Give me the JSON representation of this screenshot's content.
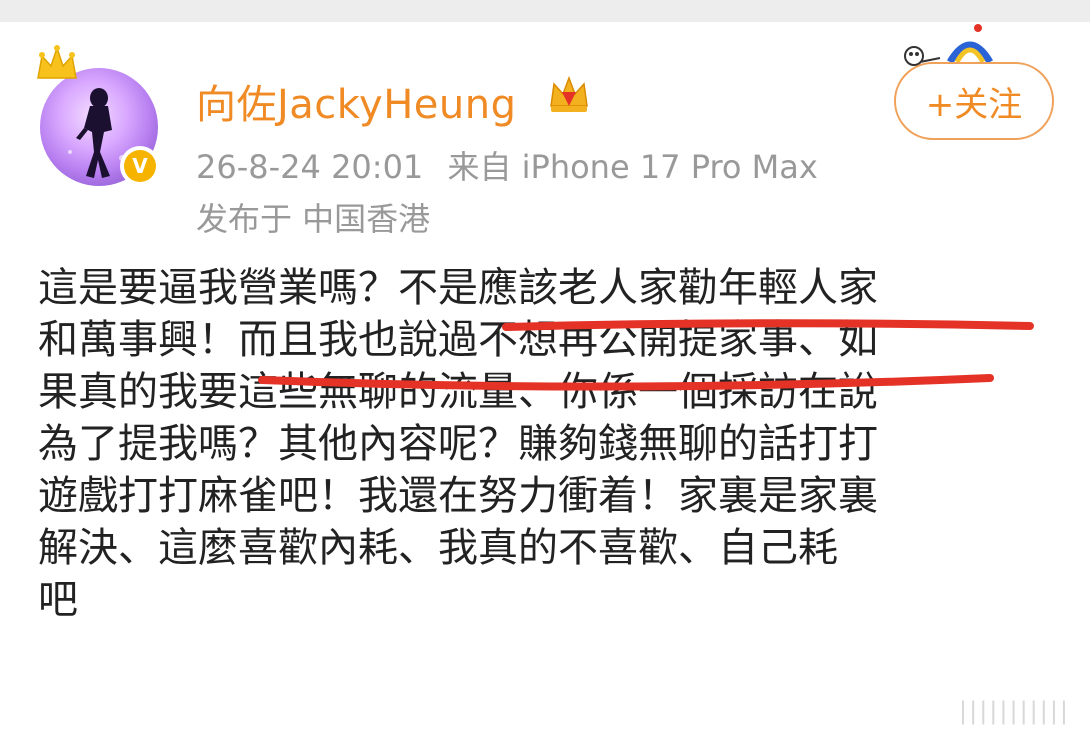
{
  "post": {
    "username": "向佐JackyHeung",
    "timestamp": "26-8-24 20:01",
    "source": "来自 iPhone 17 Pro Max",
    "location": "发布于 中国香港",
    "follow_label": "+关注",
    "lines": [
      "這是要逼我營業嗎？不是應該老人家勸年輕人家",
      "和萬事興！而且我也說過不想再公開提家事、如",
      "果真的我要這些無聊的流量、你係一個採訪在說",
      "為了提我嗎？其他內容呢？賺夠錢無聊的話打打",
      "遊戲打打麻雀吧！我還在努力衝着！家裏是家裏",
      "解決、這麼喜歡內耗、我真的不喜歡、自己耗",
      "吧"
    ],
    "watermark": "|||||||||||"
  },
  "colors": {
    "username": "#f08a24",
    "meta": "#999999",
    "body_text": "#222222",
    "underline": "#e53226",
    "verified": "#f6b400"
  },
  "icons": {
    "crown": "crown-icon",
    "verified": "verified-badge-icon",
    "vip": "vip-crown-icon"
  }
}
